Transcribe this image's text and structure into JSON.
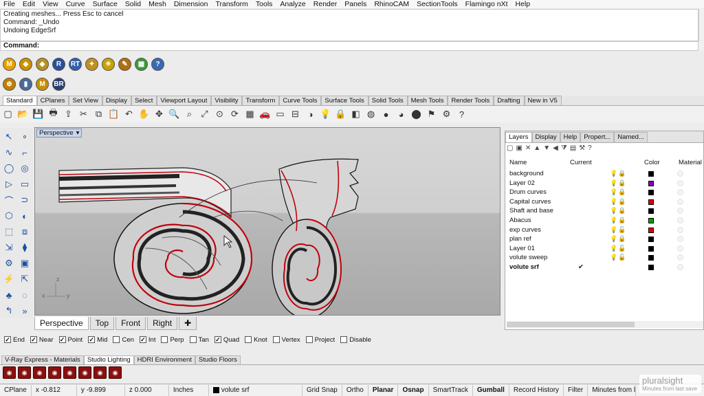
{
  "menu": [
    "File",
    "Edit",
    "View",
    "Curve",
    "Surface",
    "Solid",
    "Mesh",
    "Dimension",
    "Transform",
    "Tools",
    "Analyze",
    "Render",
    "Panels",
    "RhinoCAM",
    "SectionTools",
    "Flamingo nXt",
    "Help"
  ],
  "history": [
    "Creating meshes... Press Esc to cancel",
    "Command: _Undo",
    "Undoing EdgeSrf"
  ],
  "command": {
    "label": "Command:"
  },
  "plugins_row1": [
    {
      "t": "M",
      "c": "#e8a000"
    },
    {
      "t": "◆",
      "c": "#d09000"
    },
    {
      "t": "◆",
      "c": "#b89020"
    },
    {
      "t": "R",
      "c": "#2a4f9a"
    },
    {
      "t": "RT",
      "c": "#355fa8"
    },
    {
      "t": "✦",
      "c": "#c09020"
    },
    {
      "t": "☀",
      "c": "#c8a000"
    },
    {
      "t": "✎",
      "c": "#b07010"
    },
    {
      "t": "▦",
      "c": "#3a9a3a"
    },
    {
      "t": "?",
      "c": "#3a6ab0"
    }
  ],
  "plugins_row2": [
    {
      "t": "⊕",
      "c": "#c08000"
    },
    {
      "t": "▮",
      "c": "#4a6a9a"
    },
    {
      "t": "M",
      "c": "#c89000"
    },
    {
      "t": "BR",
      "c": "#2a3f70"
    }
  ],
  "toolbar_tabs": [
    "Standard",
    "CPlanes",
    "Set View",
    "Display",
    "Select",
    "Viewport Layout",
    "Visibility",
    "Transform",
    "Curve Tools",
    "Surface Tools",
    "Solid Tools",
    "Mesh Tools",
    "Render Tools",
    "Drafting",
    "New in V5"
  ],
  "active_toolbar_tab": "Standard",
  "std_tools": [
    "new-file-icon",
    "open-icon",
    "save-icon",
    "print-icon",
    "import-icon",
    "cut-icon",
    "copy-icon",
    "paste-icon",
    "undo-icon",
    "pan-icon",
    "move-view-icon",
    "zoom-icon",
    "zoom-window-icon",
    "zoom-extents-icon",
    "zoom-selected-icon",
    "rotate-view-icon",
    "four-viewports-icon",
    "car-icon",
    "plan-icon",
    "cplane-icon",
    "shade-icon",
    "light-icon",
    "lock-icon",
    "layer-icon",
    "color-wheel-icon",
    "render-sphere-icon",
    "render-sphere2-icon",
    "material-icon",
    "select-filter-icon",
    "settings-icon",
    "help-icon"
  ],
  "viewport": {
    "label": "Perspective",
    "axis_x": "x",
    "axis_y": "y",
    "axis_z": "z"
  },
  "viewport_tabs": [
    "Perspective",
    "Top",
    "Front",
    "Right"
  ],
  "viewport_add": "✚",
  "panel_tabs": [
    "Layers",
    "Display",
    "Help",
    "Propert...",
    "Named..."
  ],
  "layer_columns": {
    "name": "Name",
    "current": "Current",
    "color": "Color",
    "material": "Material"
  },
  "layers": [
    {
      "name": "background",
      "color": "#000000",
      "bulb": "#e8d020",
      "lock": "🔒"
    },
    {
      "name": "Layer 02",
      "color": "#8000c0",
      "bulb": "#3a8fd8",
      "lock": "🔒"
    },
    {
      "name": "Drum curves",
      "color": "#000000",
      "bulb": "#3a8fd8",
      "lock": "🔒"
    },
    {
      "name": "Capital curves",
      "color": "#e00000",
      "bulb": "#3a8fd8",
      "lock": "🔒"
    },
    {
      "name": "Shaft and base",
      "color": "#000000",
      "bulb": "#3a8fd8",
      "lock": "🔒"
    },
    {
      "name": "Abacus",
      "color": "#00a000",
      "bulb": "#3a8fd8",
      "lock": "🔒"
    },
    {
      "name": "exp curves",
      "color": "#e00000",
      "bulb": "#e8d020",
      "lock": "🔓"
    },
    {
      "name": "plan ref",
      "color": "#000000",
      "bulb": "#e8d020",
      "lock": "🔒"
    },
    {
      "name": "Layer 01",
      "color": "#000000",
      "bulb": "#e8d020",
      "lock": "🔓"
    },
    {
      "name": "volute sweep",
      "color": "#000000",
      "bulb": "#e8d020",
      "lock": "🔓"
    },
    {
      "name": "volute srf",
      "color": "#000000",
      "bulb": "",
      "lock": "",
      "current": "✔"
    }
  ],
  "osnaps": [
    {
      "label": "End",
      "checked": true
    },
    {
      "label": "Near",
      "checked": true
    },
    {
      "label": "Point",
      "checked": true
    },
    {
      "label": "Mid",
      "checked": true
    },
    {
      "label": "Cen",
      "checked": false
    },
    {
      "label": "Int",
      "checked": true
    },
    {
      "label": "Perp",
      "checked": false
    },
    {
      "label": "Tan",
      "checked": false
    },
    {
      "label": "Quad",
      "checked": true
    },
    {
      "label": "Knot",
      "checked": false
    },
    {
      "label": "Vertex",
      "checked": false
    },
    {
      "label": "Project",
      "checked": false
    },
    {
      "label": "Disable",
      "checked": false
    }
  ],
  "vray_tabs": [
    "V-Ray Express - Materials",
    "Studio Lighting",
    "HDRI Environment",
    "Studio Floors"
  ],
  "active_vray_tab": "Studio Lighting",
  "status": {
    "cplane": "CPlane",
    "x": "x -0.812",
    "y": "y -9.899",
    "z": "z 0.000",
    "units": "Inches",
    "layer": "volute srf",
    "grid_snap": "Grid Snap",
    "ortho": "Ortho",
    "planar": "Planar",
    "osnap": "Osnap",
    "smarttrack": "SmartTrack",
    "gumball": "Gumball",
    "record_history": "Record History",
    "filter": "Filter",
    "minutes": "Minutes from last save"
  },
  "watermark": {
    "brand": "pluralsight",
    "sub": "Minutes from last save"
  }
}
